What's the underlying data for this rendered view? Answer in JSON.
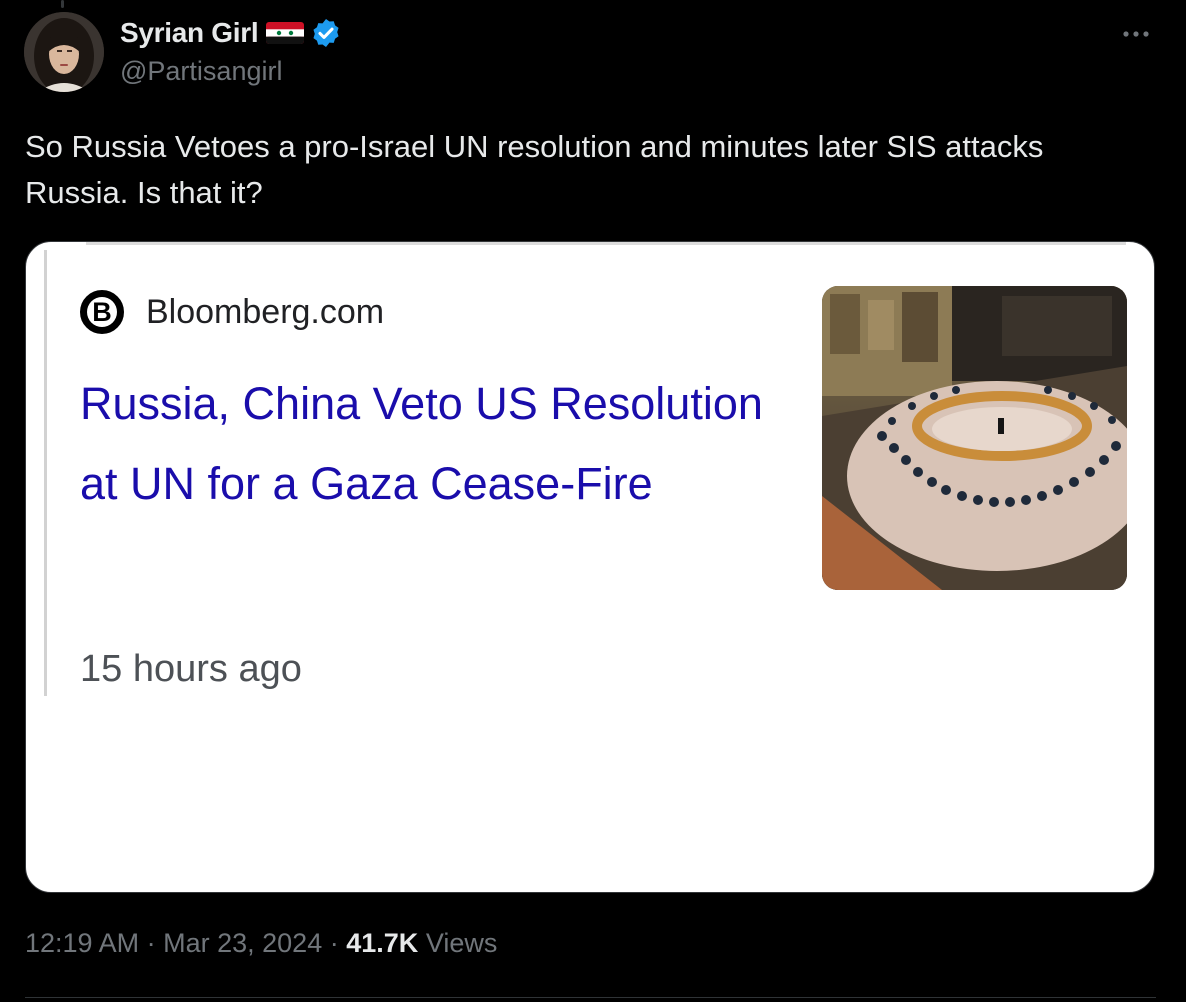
{
  "author": {
    "display_name": "Syrian Girl",
    "handle": "@Partisangirl",
    "avatar_icon": "profile-photo",
    "flag_icon": "syria-flag-emoji",
    "verified_icon": "verified-badge",
    "verified_color": "#1d9bf0"
  },
  "tweet": {
    "text": "So Russia Vetoes a pro-Israel UN resolution and minutes later SIS attacks Russia. Is that it?",
    "more_icon": "more-horizontal-icon"
  },
  "card": {
    "source_logo_letter": "B",
    "source_name": "Bloomberg.com",
    "headline": "Russia, China Veto US Resolution at UN for a Gaza Cease-Fire",
    "time_ago": "15 hours ago",
    "thumbnail": "un-security-council-chamber-photo",
    "headline_color": "#1a0dab"
  },
  "meta": {
    "time": "12:19 AM",
    "separator": "·",
    "date": "Mar 23, 2024",
    "views_count": "41.7K",
    "views_label": "Views"
  },
  "colors": {
    "background": "#000000",
    "text_primary": "#e7e9ea",
    "text_secondary": "#71767b",
    "border": "#333639"
  }
}
